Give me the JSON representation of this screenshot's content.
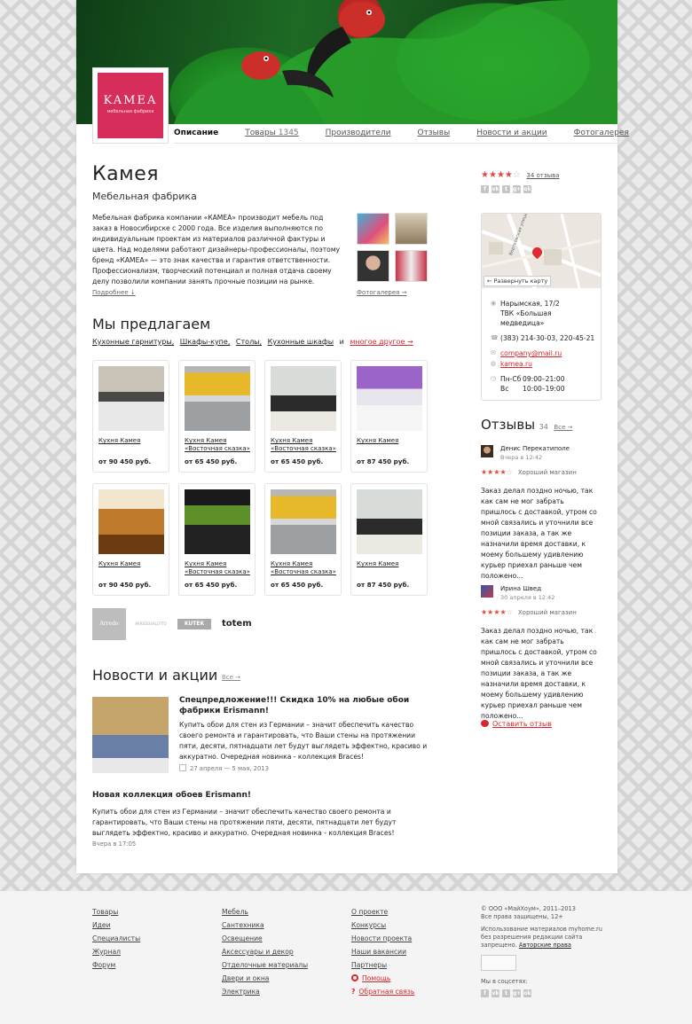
{
  "logo": {
    "name": "KAMEA",
    "tagline": "мебельная фабрика"
  },
  "tabs": [
    {
      "label": "Описание"
    },
    {
      "label": "Товары",
      "count": "1345"
    },
    {
      "label": "Производители"
    },
    {
      "label": "Отзывы"
    },
    {
      "label": "Новости и акции"
    },
    {
      "label": "Фотогалерея"
    }
  ],
  "company": {
    "title": "Камея",
    "subtitle": "Мебельная фабрика",
    "description": "Мебельная фабрика компании «КАМЕА» производит мебель под заказ в Новосибирске с 2000 года. Все изделия выполняются по индивидуальным проектам из материалов различной фактуры и цвета. Над моделями работают дизайнеры-профессионалы, поэтому бренд «КАМЕА» — это знак качества и гарантия ответственности. Профессионализм, творческий потенциал и полная отдача своему делу позволили компании занять прочные позиции на рынке.",
    "more_label": "Подробнее ↓",
    "gallery_label": "Фотогалерея →"
  },
  "offer": {
    "title": "Мы предлагаем",
    "categories": [
      "Кухонные гарнитуры,",
      "Шкафы-купе,",
      "Столы,",
      "Кухонные шкафы",
      "и"
    ],
    "more": "многое другое →"
  },
  "products": [
    {
      "name": "Кухня Камея",
      "price": "от 90 450 руб."
    },
    {
      "name": "Кухня Камея «Восточная сказка»",
      "price": "от 65 450 руб."
    },
    {
      "name": "Кухня Камея «Восточная сказка»",
      "price": "от 65 450 руб."
    },
    {
      "name": "Кухня Камея",
      "price": "от 87 450 руб."
    },
    {
      "name": "Кухня Камея",
      "price": "от 90 450 руб."
    },
    {
      "name": "Кухня Камея «Восточная сказка»",
      "price": "от 65 450 руб."
    },
    {
      "name": "Кухня Камея «Восточная сказка»",
      "price": "от 65 450 руб."
    },
    {
      "name": "Кухня Камея",
      "price": "от 87 450 руб."
    }
  ],
  "brands": [
    "Arredo",
    "ARREDOSALOTTO",
    "KUTEK",
    "totem"
  ],
  "news": {
    "title": "Новости и акции",
    "all": "Все →",
    "items": [
      {
        "title": "Спецпредложение!!! Скидка 10% на любые обои фабрики Erismann!",
        "text": "Купить обои для стен из Германии – значит обеспечить качество своего ремонта и гарантировать, что Ваши стены на протяжении пяти, десяти, пятнадцати лет будут выглядеть эффектно, красиво и аккуратно. Очередная новинка - коллекция Braces!",
        "date": "27 апреля — 5 мая, 2013"
      },
      {
        "title": "Новая коллекция обоев Erismann!",
        "text": "Купить обои для стен из Германии – значит обеспечить качество своего ремонта и гарантировать, что Ваши стены на протяжении пяти, десяти, пятнадцати лет будут выглядеть эффектно, красиво и аккуратно. Очередная новинка - коллекция Braces!",
        "date": "Вчера в 17:05"
      }
    ]
  },
  "rating": {
    "value": 4,
    "max": 5,
    "count_label": "34 отзыва"
  },
  "socials": [
    "f",
    "vk",
    "t",
    "g+",
    "ok"
  ],
  "map": {
    "street": "Вертковская улица",
    "expand": "← Развернуть карту"
  },
  "contacts": {
    "address": "Нарымская, 17/2",
    "mall": "ТВК «Большая медведица»",
    "phone": "(383) 214-30-03, 220-45-21",
    "email": "company@mail.ru",
    "site": "kamea.ru",
    "hours": [
      {
        "days": "Пн-Сб",
        "time": "09:00–21:00"
      },
      {
        "days": "Вс",
        "time": "10:00–19:00"
      }
    ]
  },
  "reviews": {
    "title": "Отзывы",
    "count": "34",
    "all": "Все →",
    "items": [
      {
        "name": "Денис Перекатиполе",
        "date": "Вчера в 12:42",
        "rating": 4,
        "label": "Хороший магазин",
        "text": "Заказ делал поздно ночью, так как сам не мог забрать пришлось с доставкой, утром со мной связались и уточнили все позиции заказа, а так же назначили время доставки, к моему большему удивлению курьер приехал раньше чем положено..."
      },
      {
        "name": "Ирина Швед",
        "date": "30 апреля в 12:42",
        "rating": 4,
        "label": "Хороший магазин",
        "text": "Заказ делал поздно ночью, так как сам не мог забрать пришлось с доставкой, утром со мной связались и уточнили все позиции заказа, а так же назначили время доставки, к моему большему удивлению курьер приехал раньше чем положено..."
      }
    ],
    "leave": "Оставить отзыв"
  },
  "footer": {
    "col1": [
      "Товары",
      "Идеи",
      "Специалисты",
      "Журнал",
      "Форум"
    ],
    "col2": [
      "Мебель",
      "Сантехника",
      "Освещение",
      "Аксессуары и декор",
      "Отделочные материалы",
      "Двери и окна",
      "Электрика"
    ],
    "col3": [
      "О проекте",
      "Конкурсы",
      "Новости проекта",
      "Наши вакансии",
      "Партнеры",
      "Помощь",
      "Обратная связь"
    ],
    "copyright": "© ООО «МайХоум», 2011–2013",
    "rights": "Все права защищены, 12+",
    "notice": "Использование материалов myhome.ru без разрешения редакции сайта запрещено.",
    "notice_link": "Авторские права",
    "social_title": "Мы в соцсетях:"
  },
  "colors": {
    "accent": "#d8262c",
    "logo_bg": "#d72d5a",
    "stars": "#e04c3d"
  }
}
